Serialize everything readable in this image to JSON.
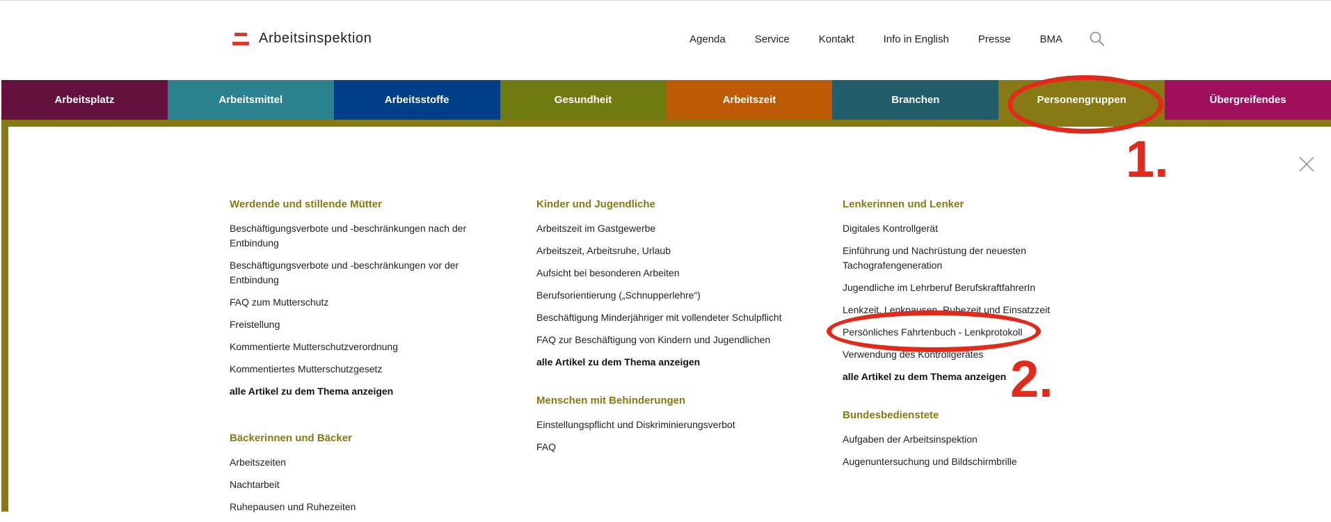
{
  "logo": {
    "text": "Arbeitsinspektion"
  },
  "topnav": [
    "Agenda",
    "Service",
    "Kontakt",
    "Info in English",
    "Presse",
    "BMA"
  ],
  "mainnav": [
    {
      "label": "Arbeitsplatz",
      "color": "#65113e"
    },
    {
      "label": "Arbeitsmittel",
      "color": "#2a828f"
    },
    {
      "label": "Arbeitsstoffe",
      "color": "#013f88"
    },
    {
      "label": "Gesundheit",
      "color": "#6f7b10"
    },
    {
      "label": "Arbeitszeit",
      "color": "#bd5b05"
    },
    {
      "label": "Branchen",
      "color": "#225d6a"
    },
    {
      "label": "Personengruppen",
      "color": "#877a14"
    },
    {
      "label": "Übergreifendes",
      "color": "#9f0f5b"
    }
  ],
  "columns": [
    [
      {
        "title": "Werdende und stillende Mütter",
        "links": [
          "Beschäftigungsverbote und -beschränkungen nach der Entbindung",
          "Beschäftigungsverbote und -beschränkungen vor der Entbindung",
          "FAQ zum Mutterschutz",
          "Freistellung",
          "Kommentierte Mutterschutzverordnung",
          "Kommentiertes Mutterschutzgesetz"
        ],
        "all": "alle Artikel zu dem Thema anzeigen"
      },
      {
        "title": "Bäckerinnen und Bäcker",
        "links": [
          "Arbeitszeiten",
          "Nachtarbeit",
          "Ruhepausen und Ruhezeiten"
        ]
      }
    ],
    [
      {
        "title": "Kinder und Jugendliche",
        "links": [
          "Arbeitszeit im Gastgewerbe",
          "Arbeitszeit, Arbeitsruhe, Urlaub",
          "Aufsicht bei besonderen Arbeiten",
          "Berufsorientierung („Schnupperlehre“)",
          "Beschäftigung Minderjähriger mit vollendeter Schulpflicht",
          "FAQ zur Beschäftigung von Kindern und Jugendlichen"
        ],
        "all": "alle Artikel zu dem Thema anzeigen"
      },
      {
        "title": "Menschen mit Behinderungen",
        "links": [
          "Einstellungspflicht und Diskriminierungsverbot",
          "FAQ"
        ]
      }
    ],
    [
      {
        "title": "Lenkerinnen und Lenker",
        "links": [
          "Digitales Kontrollgerät",
          "Einführung und Nachrüstung der neuesten Tachografengeneration",
          "Jugendliche im Lehrberuf BerufskraftfahrerIn",
          "Lenkzeit, Lenkpausen, Ruhezeit und Einsatzzeit",
          "Persönliches Fahrtenbuch - Lenkprotokoll",
          "Verwendung des Kontrollgerätes"
        ],
        "all": "alle Artikel zu dem Thema anzeigen"
      },
      {
        "title": "Bundesbedienstete",
        "links": [
          "Aufgaben der Arbeitsinspektion",
          "Augenuntersuchung und Bildschirmbrille"
        ]
      }
    ]
  ],
  "annotations": {
    "step1": "1.",
    "step2": "2.",
    "color": "#e32a1a"
  }
}
